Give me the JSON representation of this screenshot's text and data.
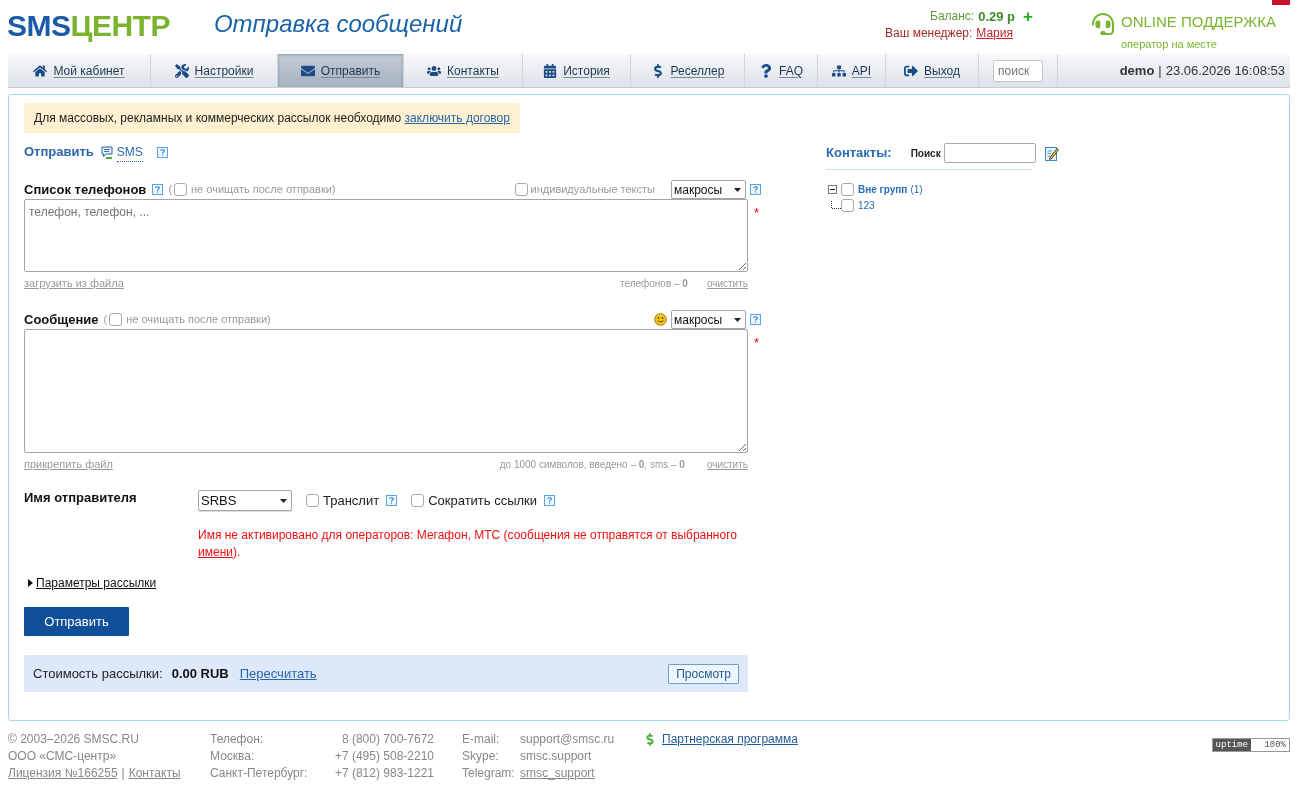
{
  "header": {
    "logo": {
      "part_1": "SMS",
      "part_2": "ЦЕНТР"
    },
    "title": "Отправка сообщений",
    "balance": {
      "label": "Баланс:",
      "value": "0.29 р",
      "add": "+"
    },
    "manager": {
      "label": "Ваш менеджер:",
      "name": "Мария"
    },
    "support": {
      "title": "ONLINE ПОДДЕРЖКА",
      "status": "оператор на месте"
    }
  },
  "nav": {
    "items": [
      {
        "label": "Мой кабинет",
        "selected": false
      },
      {
        "label": "Настройки",
        "selected": false
      },
      {
        "label": "Отправить",
        "selected": true
      },
      {
        "label": "Контакты",
        "selected": false
      },
      {
        "label": "История",
        "selected": false
      },
      {
        "label": "Реселлер",
        "selected": false
      },
      {
        "label": "FAQ",
        "selected": false
      },
      {
        "label": "API",
        "selected": false
      },
      {
        "label": "Выход",
        "selected": false
      }
    ],
    "search": {
      "placeholder": "поиск"
    },
    "user": "demo",
    "separator": "|",
    "datetime": "23.06.2026 16:08:53"
  },
  "notice": {
    "text": "Для массовых, рекламных и коммерческих рассылок необходимо",
    "link": "заключить договор"
  },
  "send_type": {
    "label": "Отправить",
    "type": "SMS"
  },
  "phones": {
    "label": "Список телефонов",
    "keep": {
      "prefix": "(",
      "label": "не очищать после отправки)",
      "checked": false
    },
    "individual": {
      "label": "индивидуальные тексты",
      "checked": false
    },
    "macros": "макросы",
    "placeholder": "телефон, телефон, ...",
    "required": "*",
    "file_link": "загрузить из файла",
    "counter": "телефонов – **0**",
    "clear": "очистить"
  },
  "message": {
    "label": "Сообщение",
    "keep": {
      "prefix": "(",
      "label": "не очищать после отправки)",
      "checked": false
    },
    "macros": "макросы",
    "required": "*",
    "file_link": "прикрепить файл",
    "counter": "до 1000 символов, введено – **0**, sms – **0**",
    "clear": "очистить"
  },
  "sender": {
    "label": "Имя отправителя",
    "value": "SRBS",
    "options": [
      {
        "label": "Транслит",
        "checked": false
      },
      {
        "label": "Сократить ссылки",
        "checked": false
      }
    ],
    "warning": {
      "text": "Имя не активировано для операторов: Мегафон, МТС (сообщения не отправятся от выбранного",
      "link": "имени",
      "end": ")."
    }
  },
  "params": {
    "label": "Параметры рассылки",
    "expanded": false
  },
  "submit": "Отправить",
  "cost": {
    "label": "Стоимость рассылки:",
    "value": "0.00 RUB",
    "recalc": "Пересчитать",
    "preview": "Просмотр"
  },
  "contacts": {
    "title": "Контакты:",
    "search_label": "Поиск",
    "tree": [
      {
        "label": "Вне групп",
        "count": "(1)",
        "checked": false,
        "expanded": true,
        "children": [
          {
            "label": "123",
            "checked": false
          }
        ]
      }
    ]
  },
  "footer": {
    "copyright": "© 2003–2026 SMSC.RU",
    "company": "ООО «СМС-центр»",
    "license": "Лицензия №166255",
    "separator": "|",
    "contacts_link": "Контакты",
    "phones": [
      {
        "label": "Телефон:",
        "value": "8 (800) 700-7672"
      },
      {
        "label": "Москва:",
        "value": "+7 (495) 508-2210"
      },
      {
        "label": "Санкт-Петербург:",
        "value": "+7 (812) 983-1221"
      }
    ],
    "channels": [
      {
        "label": "E-mail:",
        "value": "support@smsc.ru",
        "kind": "text"
      },
      {
        "label": "Skype:",
        "value": "smsc.support",
        "kind": "text"
      },
      {
        "label": "Telegram:",
        "value": "smsc_support",
        "kind": "link"
      }
    ],
    "partner": "Партнерская программа",
    "uptime": {
      "label": "uptime",
      "value": "100%"
    }
  }
}
